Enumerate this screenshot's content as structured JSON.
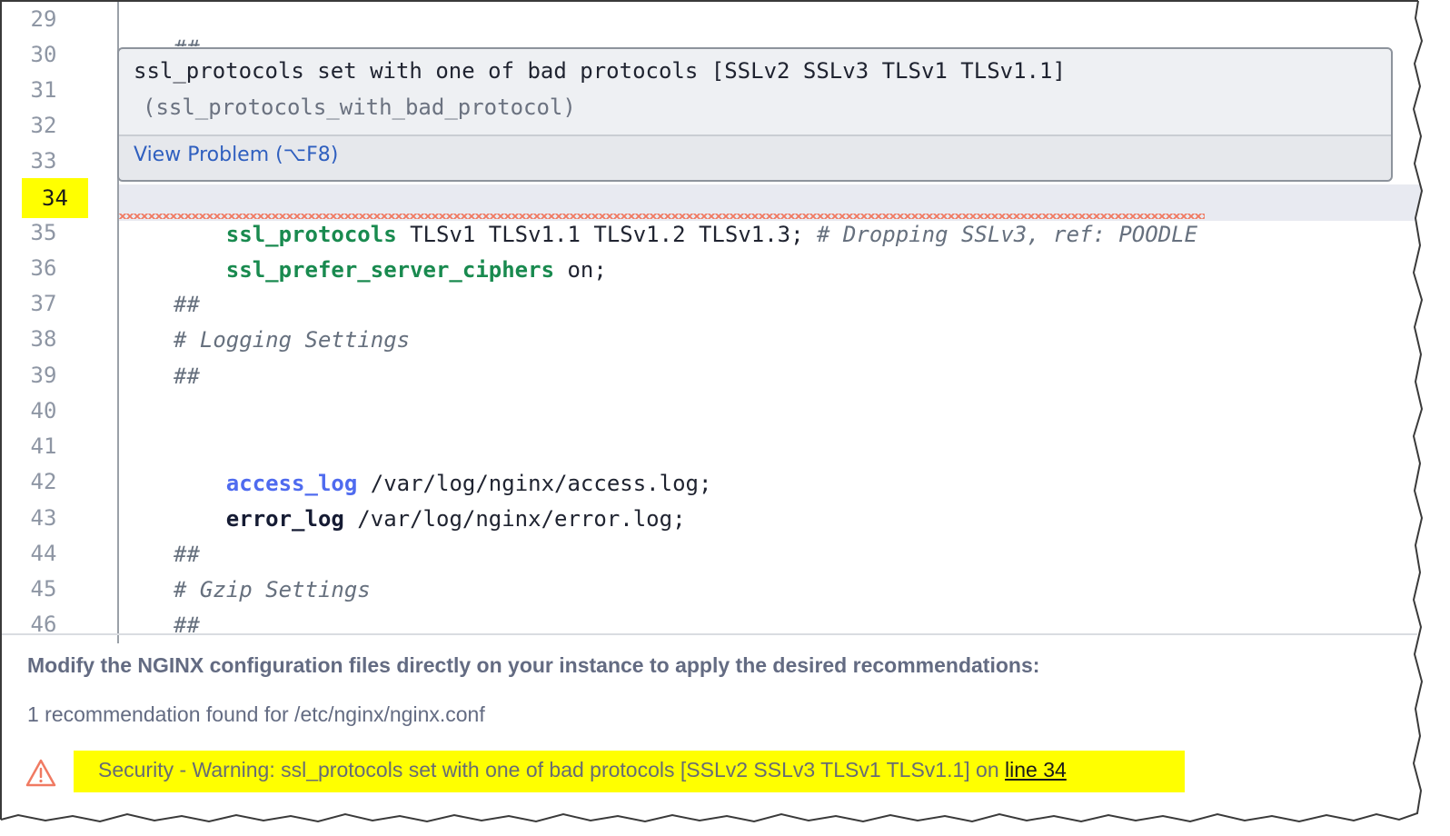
{
  "editor": {
    "gutter_lines": [
      "29",
      "30",
      "31",
      "32",
      "33",
      "34",
      "35",
      "36",
      "37",
      "38",
      "39",
      "40",
      "41",
      "42",
      "43",
      "44",
      "45",
      "46"
    ],
    "active_line": "34",
    "lines": {
      "l30": "##",
      "l34_key": "ssl_protocols",
      "l34_val": " TLSv1 TLSv1.1 TLSv1.2 TLSv1.3;",
      "l34_comment": " # Dropping SSLv3, ref: POODLE",
      "l35_key": "ssl_prefer_server_ciphers",
      "l35_val": " on;",
      "l37": "##",
      "l38": "# Logging Settings",
      "l39": "##",
      "l41_key": "access_log",
      "l41_val": " /var/log/nginx/access.log;",
      "l42_key": "error_log",
      "l42_val": " /var/log/nginx/error.log;",
      "l44": "##",
      "l45": "# Gzip Settings",
      "l46": "##"
    }
  },
  "tooltip": {
    "message": "ssl_protocols set with one of bad protocols [SSLv2 SSLv3 TLSv1 TLSv1.1]",
    "rule_id": "(ssl_protocols_with_bad_protocol)",
    "link_label": "View Problem (⌥F8)"
  },
  "panel": {
    "heading": "Modify the NGINX configuration files directly on your instance to apply the desired recommendations:",
    "summary": "1 recommendation found for /etc/nginx/nginx.conf",
    "warning_text": "Security - Warning: ssl_protocols set with one of bad protocols [SSLv2 SSLv3 TLSv1 TLSv1.1] on ",
    "warning_link": "line 34",
    "warning_icon": "warning-triangle-icon"
  },
  "colors": {
    "highlight": "#ffff00",
    "keyword_green": "#198a4f",
    "keyword_blue": "#4f6bef",
    "warning_orange": "#f07a62",
    "link": "#2f5fbf"
  }
}
